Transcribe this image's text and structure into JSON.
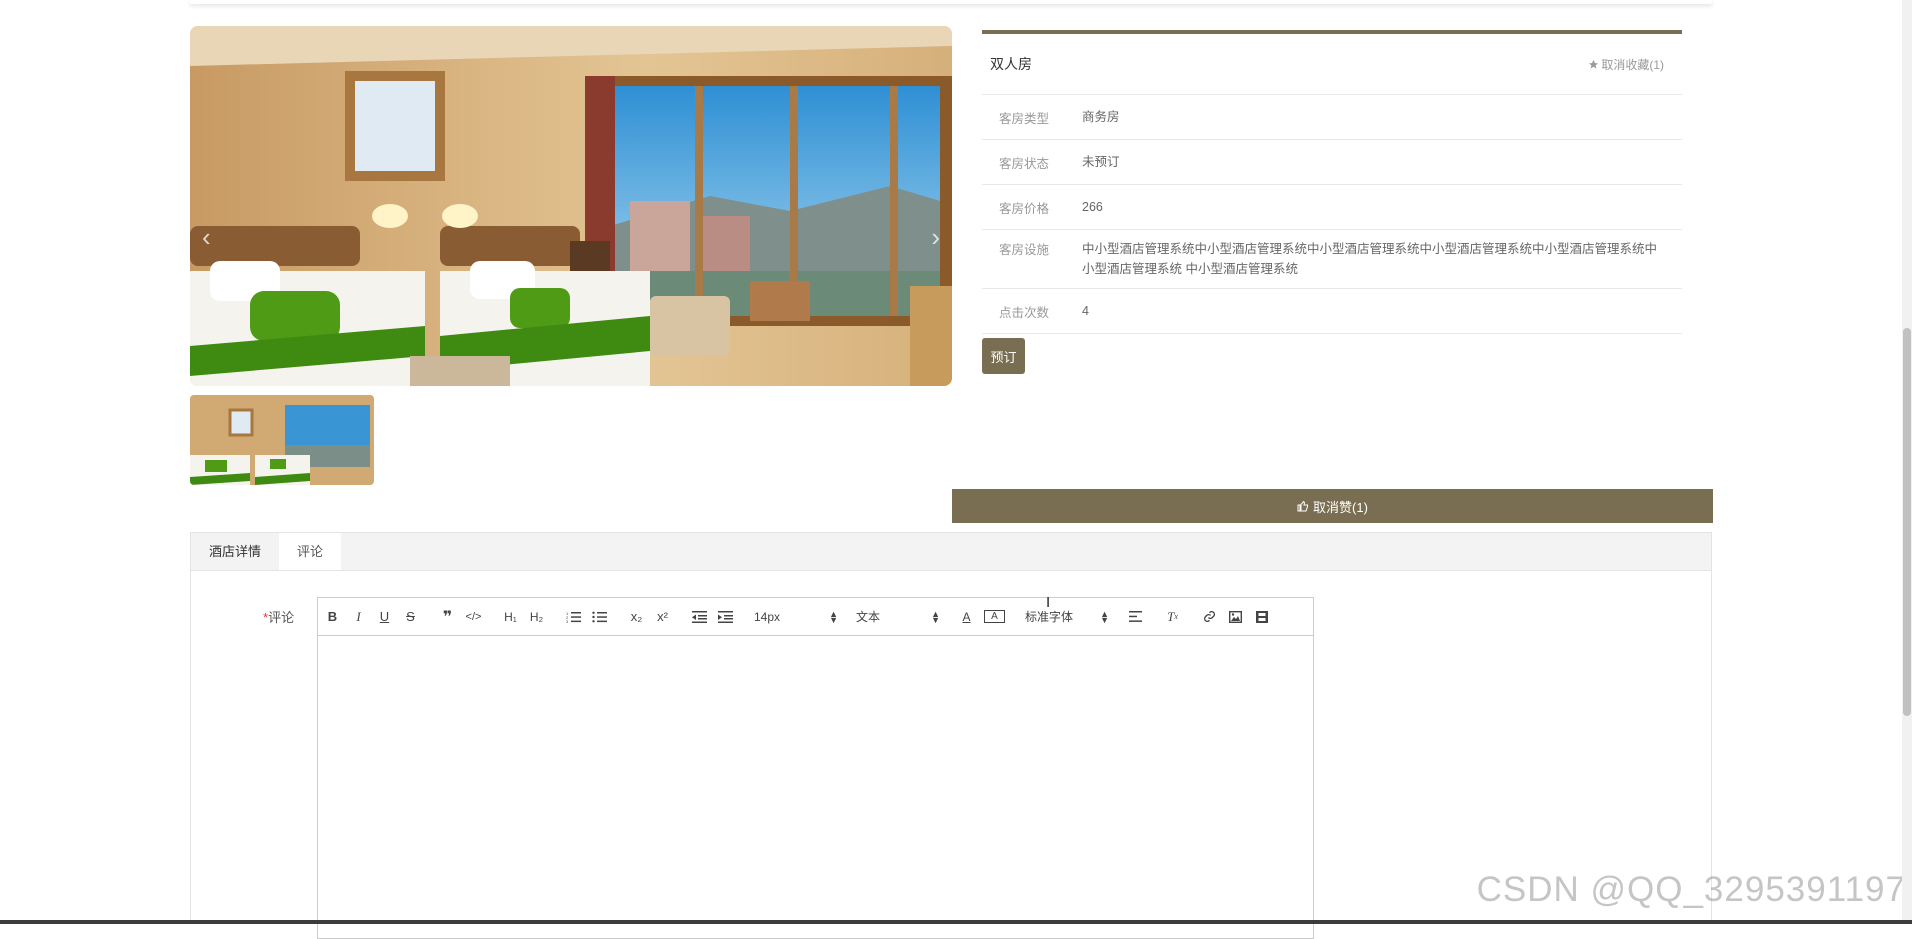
{
  "room": {
    "title": "双人房",
    "favorite_label": "取消收藏(1)",
    "favorite_icon": "star-icon",
    "fields": [
      {
        "label": "客房类型",
        "value": "商务房"
      },
      {
        "label": "客房状态",
        "value": "未预订"
      },
      {
        "label": "客房价格",
        "value": "266"
      },
      {
        "label": "客房设施",
        "value": "中小型酒店管理系统中小型酒店管理系统中小型酒店管理系统中小型酒店管理系统中小型酒店管理系统中小型酒店管理系统 中小型酒店管理系统"
      },
      {
        "label": "点击次数",
        "value": "4"
      }
    ],
    "book_label": "预订"
  },
  "carousel": {
    "prev_icon": "chevron-left-icon",
    "next_icon": "chevron-right-icon"
  },
  "like": {
    "label": "取消赞(1)",
    "icon": "thumbs-up-icon"
  },
  "tabs": [
    {
      "label": "酒店详情",
      "active": true
    },
    {
      "label": "评论",
      "active": false
    }
  ],
  "comment_form": {
    "required_mark": "*",
    "label": "评论",
    "font_size": "14px",
    "text_type": "文本",
    "font_family": "标准字体",
    "content": ""
  },
  "watermark": "CSDN @QQ_3295391197",
  "colors": {
    "accent": "#7a6e52"
  }
}
